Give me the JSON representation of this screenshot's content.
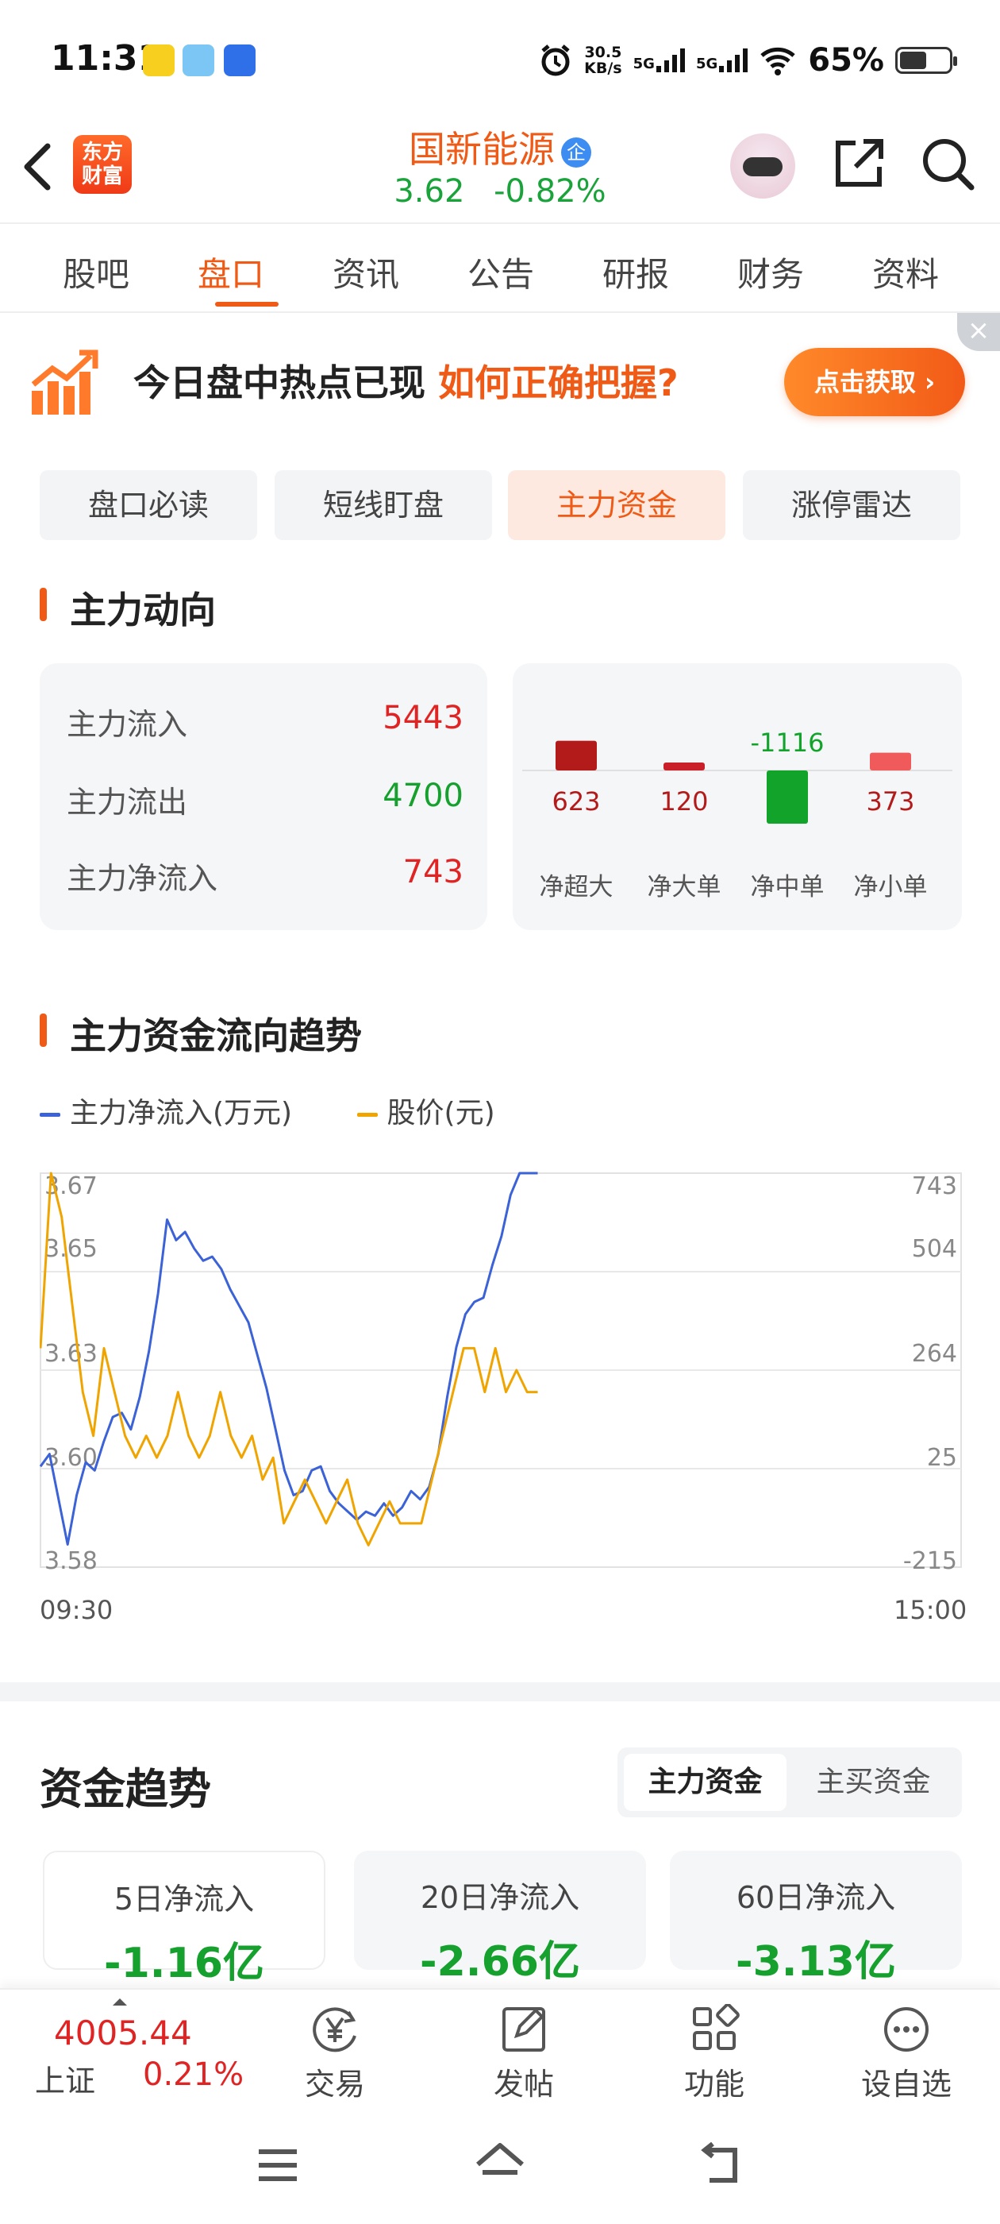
{
  "status_bar": {
    "time": "11:31",
    "net_speed_value": "30.5",
    "net_speed_unit": "KB/s",
    "sim1": "5G",
    "sim2": "5G",
    "battery": "65%"
  },
  "header": {
    "logo_text_line1": "东方",
    "logo_text_line2": "财富",
    "stock_name": "国新能源",
    "badge": "企",
    "price": "3.62",
    "change": "-0.82%"
  },
  "tabs": [
    "股吧",
    "盘口",
    "资讯",
    "公告",
    "研报",
    "财务",
    "资料"
  ],
  "banner": {
    "text": "今日盘中热点已现",
    "em": "如何正确把握?",
    "button": "点击获取 ›",
    "close": "×"
  },
  "subtabs": [
    "盘口必读",
    "短线盯盘",
    "主力资金",
    "涨停雷达"
  ],
  "main_flow": {
    "title": "主力动向",
    "rows": [
      {
        "label": "主力流入",
        "value": "5443"
      },
      {
        "label": "主力流出",
        "value": "4700"
      },
      {
        "label": "主力净流入",
        "value": "743"
      }
    ],
    "bars": [
      {
        "label": "净超大",
        "value": 623,
        "color": "#b31b1b"
      },
      {
        "label": "净大单",
        "value": 120,
        "color": "#c9202a"
      },
      {
        "label": "净中单",
        "value": -1116,
        "color": "#12a32a"
      },
      {
        "label": "净小单",
        "value": 373,
        "color": "#f05a5a"
      }
    ]
  },
  "trend": {
    "title": "主力资金流向趋势",
    "legend_net": "主力净流入(万元)",
    "legend_price": "股价(元)",
    "x_start": "09:30",
    "x_end": "15:00"
  },
  "chart_data": {
    "type": "line",
    "x_range": [
      "09:30",
      "15:00"
    ],
    "left_axis_ticks": [
      "3.67",
      "3.65",
      "3.63",
      "3.60",
      "3.58"
    ],
    "right_axis_ticks": [
      "743",
      "504",
      "264",
      "25",
      "-215"
    ],
    "ylim_price": [
      3.58,
      3.67
    ],
    "ylim_net": [
      -215,
      743
    ],
    "series": [
      {
        "name": "主力净流入(万元)",
        "color": "#3b62d6",
        "axis": "right",
        "values": [
          30,
          60,
          -50,
          -160,
          -40,
          40,
          20,
          90,
          150,
          160,
          120,
          200,
          310,
          450,
          630,
          580,
          600,
          560,
          530,
          540,
          510,
          460,
          420,
          380,
          300,
          220,
          120,
          20,
          -40,
          -30,
          20,
          30,
          -30,
          -60,
          -80,
          -100,
          -80,
          -90,
          -60,
          -90,
          -70,
          -30,
          -50,
          -20,
          60,
          200,
          320,
          400,
          430,
          440,
          520,
          590,
          690,
          743,
          743,
          743
        ]
      },
      {
        "name": "股价(元)",
        "color": "#f0a400",
        "axis": "left",
        "values": [
          3.63,
          3.67,
          3.66,
          3.64,
          3.62,
          3.61,
          3.63,
          3.62,
          3.61,
          3.605,
          3.61,
          3.605,
          3.61,
          3.62,
          3.61,
          3.605,
          3.61,
          3.62,
          3.61,
          3.605,
          3.61,
          3.6,
          3.605,
          3.59,
          3.595,
          3.6,
          3.595,
          3.59,
          3.595,
          3.6,
          3.59,
          3.585,
          3.59,
          3.595,
          3.59,
          3.59,
          3.59,
          3.6,
          3.61,
          3.62,
          3.63,
          3.63,
          3.62,
          3.63,
          3.62,
          3.625,
          3.62,
          3.62
        ]
      }
    ]
  },
  "capital_trend": {
    "title": "资金趋势",
    "toggle": [
      "主力资金",
      "主买资金"
    ],
    "cards": [
      {
        "label": "5日净流入",
        "value": "-1.16亿"
      },
      {
        "label": "20日净流入",
        "value": "-2.66亿"
      },
      {
        "label": "60日净流入",
        "value": "-3.13亿"
      }
    ]
  },
  "bottom_bar": {
    "index_value": "4005.44",
    "index_name": "上证",
    "index_change": "0.21%",
    "items": [
      "交易",
      "发帖",
      "功能",
      "设自选"
    ]
  }
}
